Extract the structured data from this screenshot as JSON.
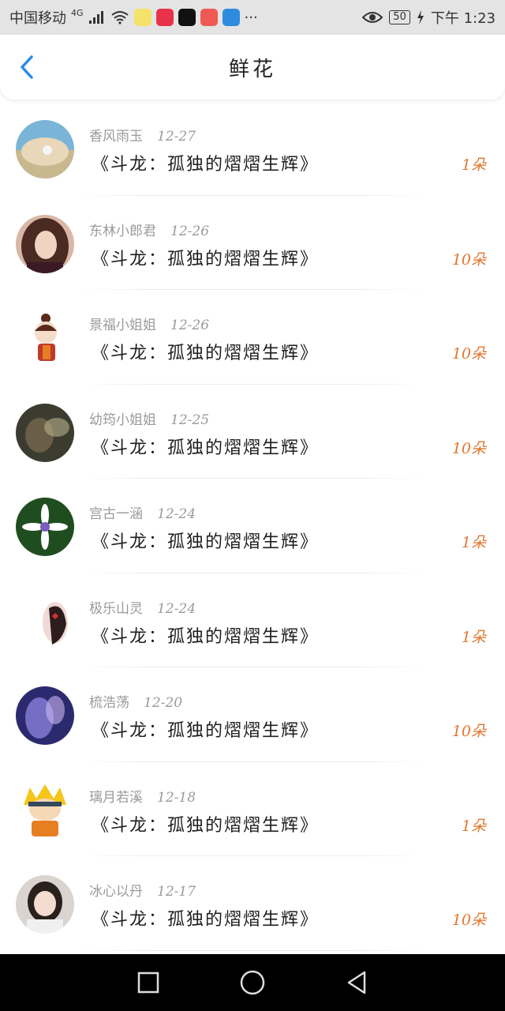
{
  "status_bar": {
    "carrier": "中国移动",
    "network": "4G",
    "battery": "50",
    "time": "下午 1:23"
  },
  "header": {
    "title": "鲜花"
  },
  "colors": {
    "accent": "#e0772f",
    "back": "#2a8ce6"
  },
  "items": [
    {
      "name": "香风雨玉",
      "date": "12-27",
      "book": "《斗龙：孤独的熠熠生辉》",
      "count": "1朵"
    },
    {
      "name": "东林小郎君",
      "date": "12-26",
      "book": "《斗龙：孤独的熠熠生辉》",
      "count": "10朵"
    },
    {
      "name": "景福小姐姐",
      "date": "12-26",
      "book": "《斗龙：孤独的熠熠生辉》",
      "count": "10朵"
    },
    {
      "name": "幼筠小姐姐",
      "date": "12-25",
      "book": "《斗龙：孤独的熠熠生辉》",
      "count": "10朵"
    },
    {
      "name": "宫古一涵",
      "date": "12-24",
      "book": "《斗龙：孤独的熠熠生辉》",
      "count": "1朵"
    },
    {
      "name": "极乐山灵",
      "date": "12-24",
      "book": "《斗龙：孤独的熠熠生辉》",
      "count": "1朵"
    },
    {
      "name": "梳浩荡",
      "date": "12-20",
      "book": "《斗龙：孤独的熠熠生辉》",
      "count": "10朵"
    },
    {
      "name": "璃月若溪",
      "date": "12-18",
      "book": "《斗龙：孤独的熠熠生辉》",
      "count": "1朵"
    },
    {
      "name": "冰心以丹",
      "date": "12-17",
      "book": "《斗龙：孤独的熠熠生辉》",
      "count": "10朵"
    }
  ]
}
